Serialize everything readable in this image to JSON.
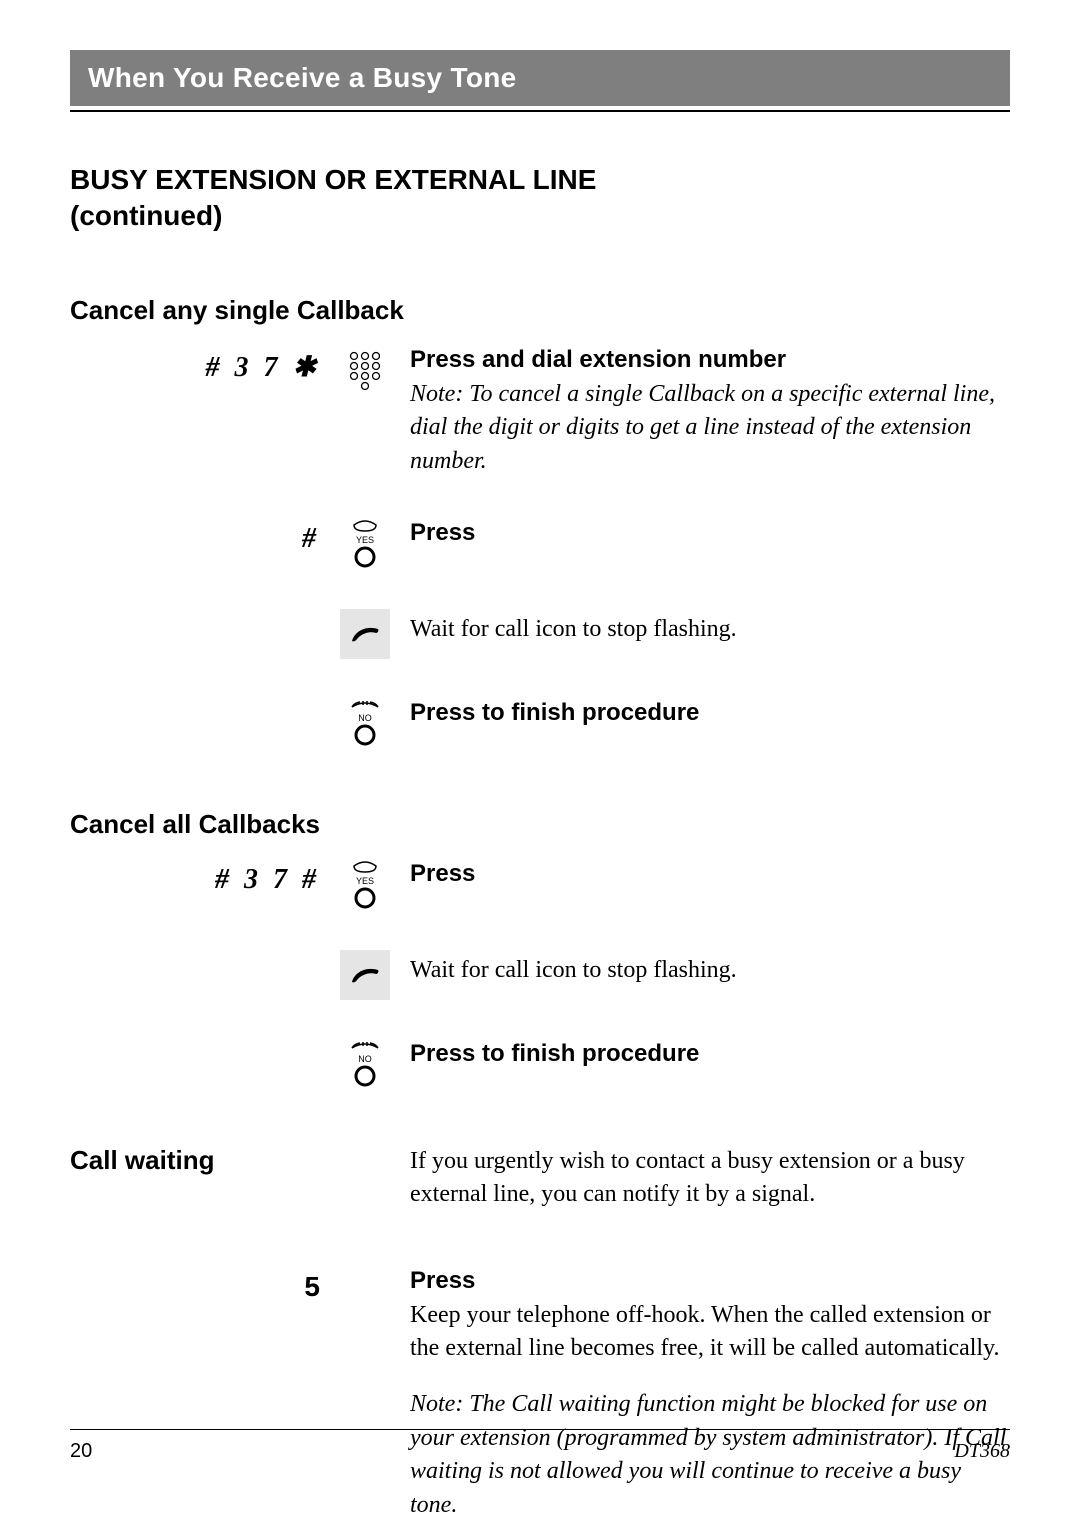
{
  "banner": {
    "title": "When You Receive a Busy Tone"
  },
  "section": {
    "title": "BUSY EXTENSION OR EXTERNAL LINE",
    "continued": "(continued)"
  },
  "cancel_single": {
    "heading": "Cancel any single Callback",
    "row1": {
      "code": "# 3 7 ✱",
      "title": "Press and dial extension number",
      "note": "Note: To cancel a single Callback on a specific external line, dial the digit or digits to get a line instead of the extension number."
    },
    "row2": {
      "code": "#",
      "title": "Press"
    },
    "row3": {
      "body": "Wait for call icon to stop flashing."
    },
    "row4": {
      "title": "Press to finish procedure"
    }
  },
  "cancel_all": {
    "heading": "Cancel all Callbacks",
    "row1": {
      "code": "# 3 7 #",
      "title": "Press"
    },
    "row2": {
      "body": "Wait for call icon to stop flashing."
    },
    "row3": {
      "title": "Press to finish procedure"
    }
  },
  "call_waiting": {
    "heading": "Call waiting",
    "intro": "If you urgently wish to contact a busy extension or a busy external line, you can notify it by a signal.",
    "row1": {
      "code": "5",
      "title": "Press",
      "body": "Keep your telephone off-hook. When the called extension or the external line becomes free, it will be called automatically.",
      "note": "Note: The Call waiting function might be blocked for use on your extension (programmed by system administrator). If Call waiting is not allowed you will continue to receive a busy tone."
    }
  },
  "footer": {
    "page": "20",
    "model": "DT368"
  },
  "icons": {
    "keypad": "keypad-icon",
    "yes": "YES",
    "no": "NO",
    "handset": "handset-icon"
  }
}
